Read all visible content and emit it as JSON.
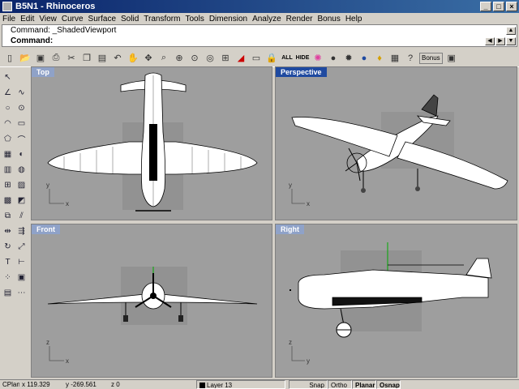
{
  "window": {
    "title": "B5N1 - Rhinoceros"
  },
  "menus": [
    "File",
    "Edit",
    "View",
    "Curve",
    "Surface",
    "Solid",
    "Transform",
    "Tools",
    "Dimension",
    "Analyze",
    "Render",
    "Bonus",
    "Help"
  ],
  "command": {
    "history_line": "Command: _ShadedViewport",
    "prompt": "Command:"
  },
  "toolbar": {
    "text_buttons": {
      "all": "ALL",
      "hide": "HIDE",
      "bonus": "Bonus"
    }
  },
  "viewports": {
    "top": {
      "label": "Top"
    },
    "perspective": {
      "label": "Perspective"
    },
    "front": {
      "label": "Front"
    },
    "right": {
      "label": "Right"
    }
  },
  "axes": {
    "x": "x",
    "y": "y",
    "z": "z"
  },
  "statusbar": {
    "cplane": "CPlane",
    "x": "x 119.329",
    "y": "y -269.561",
    "z": "z 0",
    "layer": "Layer 13",
    "snap": "Snap",
    "ortho": "Ortho",
    "planar": "Planar",
    "osnap": "Osnap"
  },
  "colors": {
    "viewport_bg": "#9e9e9e",
    "active_label": "#1f4aa0",
    "titlebar": "#0a246a"
  }
}
